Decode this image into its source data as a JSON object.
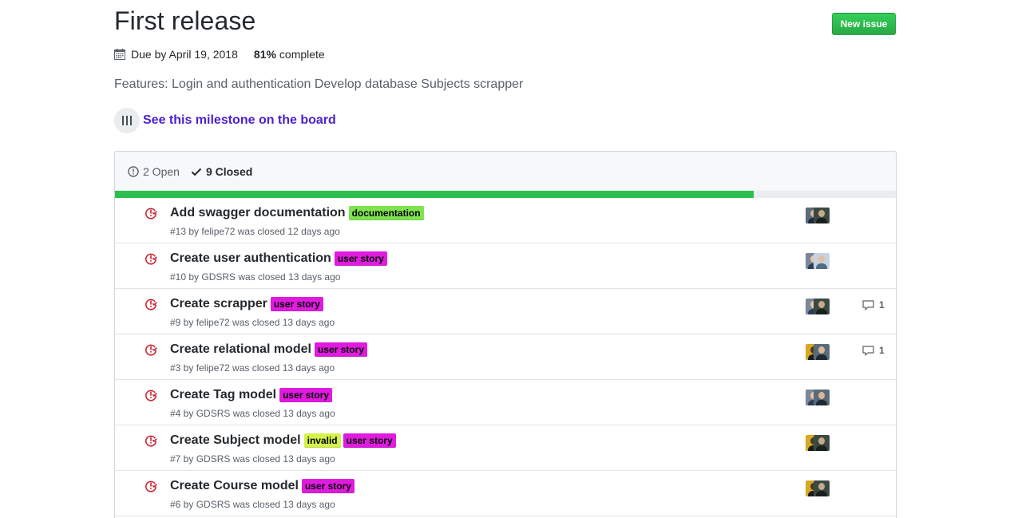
{
  "milestone": {
    "title": "First release",
    "due": "Due by April 19, 2018",
    "percent": "81%",
    "complete_label": "complete",
    "progress_fraction": 0.818,
    "description": "Features: Login and authentication Develop database Subjects scrapper",
    "board_link": "See this milestone on the board"
  },
  "new_issue_label": "New issue",
  "states": {
    "open": "2 Open",
    "closed": "9 Closed"
  },
  "colors": {
    "closed_icon": "#cb2431",
    "progress": "#2cbe4e",
    "link": "#4b1fd1"
  },
  "issues": [
    {
      "title": "Add swagger documentation",
      "labels": [
        {
          "text": "documentation",
          "color": "#7ee34f"
        }
      ],
      "meta": "#13 by felipe72 was closed 12 days ago",
      "comments": "",
      "avatars": [
        "person-a",
        "person-b"
      ]
    },
    {
      "title": "Create user authentication",
      "labels": [
        {
          "text": "user story",
          "color": "#e11ae0"
        }
      ],
      "meta": "#10 by GDSRS was closed 13 days ago",
      "comments": "",
      "avatars": [
        "person-c",
        "person-d"
      ]
    },
    {
      "title": "Create scrapper",
      "labels": [
        {
          "text": "user story",
          "color": "#e11ae0"
        }
      ],
      "meta": "#9 by felipe72 was closed 13 days ago",
      "comments": "1",
      "avatars": [
        "person-c",
        "person-b"
      ]
    },
    {
      "title": "Create relational model",
      "labels": [
        {
          "text": "user story",
          "color": "#e11ae0"
        }
      ],
      "meta": "#3 by felipe72 was closed 13 days ago",
      "comments": "1",
      "avatars": [
        "person-e",
        "person-a"
      ]
    },
    {
      "title": "Create Tag model",
      "labels": [
        {
          "text": "user story",
          "color": "#e11ae0"
        }
      ],
      "meta": "#4 by GDSRS was closed 13 days ago",
      "comments": "",
      "avatars": [
        "person-c",
        "person-a"
      ]
    },
    {
      "title": "Create Subject model",
      "labels": [
        {
          "text": "invalid",
          "color": "#d4f24b"
        },
        {
          "text": "user story",
          "color": "#e11ae0"
        }
      ],
      "meta": "#7 by GDSRS was closed 13 days ago",
      "comments": "",
      "avatars": [
        "person-e",
        "person-b"
      ]
    },
    {
      "title": "Create Course model",
      "labels": [
        {
          "text": "user story",
          "color": "#e11ae0"
        }
      ],
      "meta": "#6 by GDSRS was closed 13 days ago",
      "comments": "",
      "avatars": [
        "person-e",
        "person-b"
      ]
    }
  ]
}
